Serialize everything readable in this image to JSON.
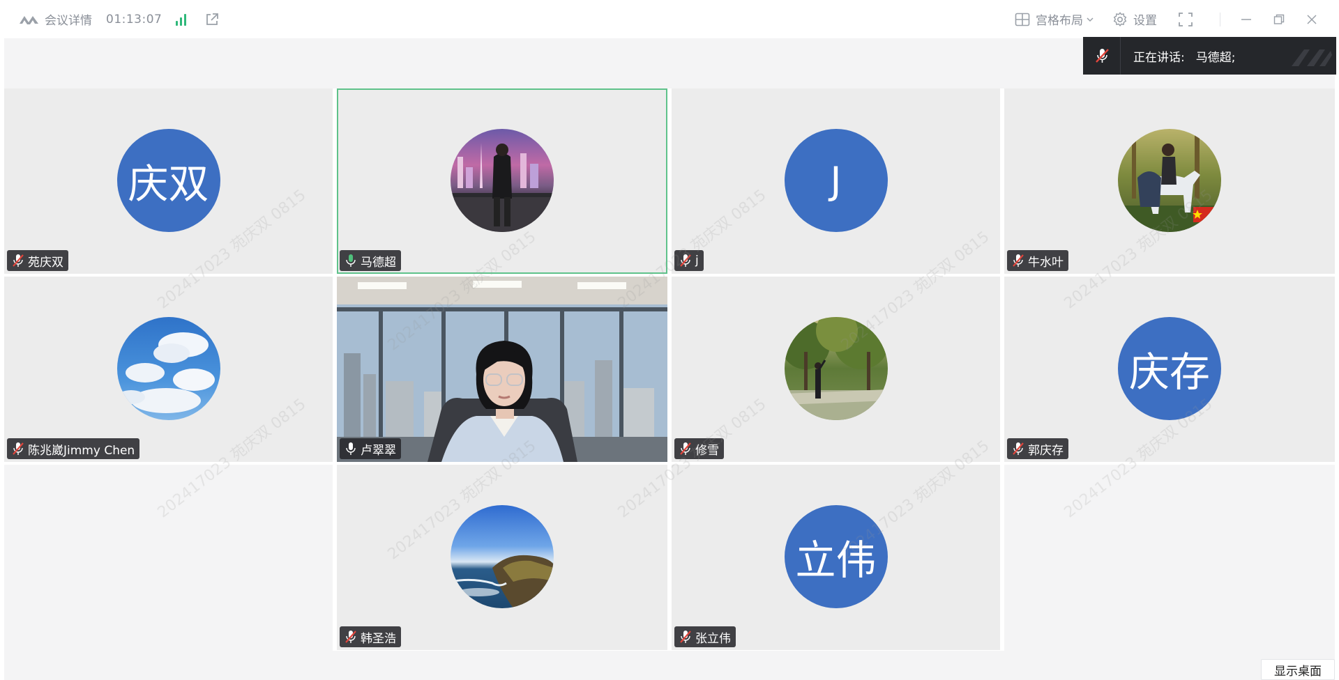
{
  "titlebar": {
    "meeting_details": "会议详情",
    "elapsed": "01:13:07",
    "layout_label": "宫格布局",
    "settings_label": "设置"
  },
  "speaking": {
    "label": "正在讲话:",
    "names": "马德超;"
  },
  "participants": [
    {
      "name": "苑庆双",
      "avatar_text": "庆双",
      "avatar_kind": "initials",
      "mic": "muted"
    },
    {
      "name": "马德超",
      "avatar_text": "",
      "avatar_kind": "photo-city-night",
      "mic": "speaking"
    },
    {
      "name": "j",
      "avatar_text": "J",
      "avatar_kind": "initials",
      "mic": "muted"
    },
    {
      "name": "牛水叶",
      "avatar_text": "",
      "avatar_kind": "photo-horse-forest",
      "mic": "muted"
    },
    {
      "name": "陈兆崴Jimmy Chen",
      "avatar_text": "",
      "avatar_kind": "photo-clouds",
      "mic": "muted"
    },
    {
      "name": "卢翠翠",
      "avatar_text": "",
      "avatar_kind": "video-office",
      "mic": "on"
    },
    {
      "name": "修雪",
      "avatar_text": "",
      "avatar_kind": "photo-park",
      "mic": "muted"
    },
    {
      "name": "郭庆存",
      "avatar_text": "庆存",
      "avatar_kind": "initials",
      "mic": "muted"
    },
    {
      "name": "韩圣浩",
      "avatar_text": "",
      "avatar_kind": "photo-coast",
      "mic": "muted"
    },
    {
      "name": "张立伟",
      "avatar_text": "立伟",
      "avatar_kind": "initials",
      "mic": "muted"
    }
  ],
  "watermark": "202417023 苑庆双 0815",
  "show_desktop": "显示桌面",
  "colors": {
    "avatar_blue": "#3d6fc2",
    "active_border": "#5ec28a",
    "signal_green": "#2fb87a",
    "tile_bg": "#ececec"
  }
}
